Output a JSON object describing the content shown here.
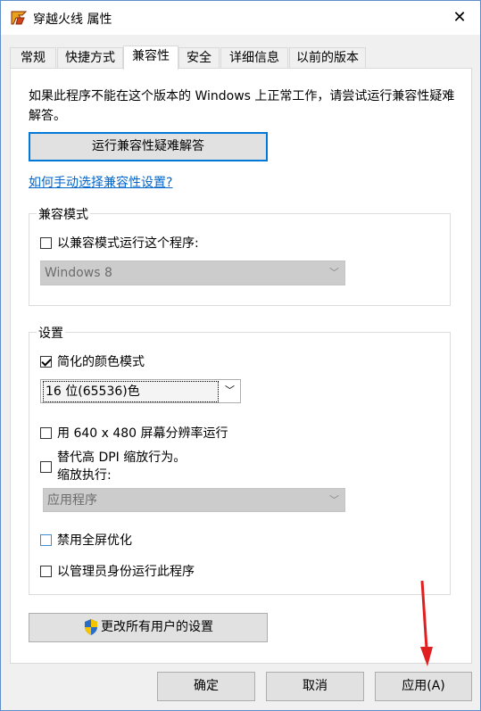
{
  "window": {
    "title": "穿越火线 属性",
    "close": "✕"
  },
  "tabs": [
    {
      "label": "常规"
    },
    {
      "label": "快捷方式"
    },
    {
      "label": "兼容性"
    },
    {
      "label": "安全"
    },
    {
      "label": "详细信息"
    },
    {
      "label": "以前的版本"
    }
  ],
  "compat": {
    "description": "如果此程序不能在这个版本的 Windows 上正常工作，请尝试运行兼容性疑难解答。",
    "troubleshoot_button": "运行兼容性疑难解答",
    "manual_link": "如何手动选择兼容性设置?"
  },
  "compat_mode": {
    "title": "兼容模式",
    "checkbox_label": "以兼容模式运行这个程序:",
    "checked": false,
    "os_select": "Windows 8"
  },
  "settings": {
    "title": "设置",
    "reduced_color_label": "简化的颜色模式",
    "reduced_color_checked": true,
    "color_select": "16 位(65536)色",
    "res_640_label": "用 640 x 480 屏幕分辨率运行",
    "dpi_label_line1": "替代高 DPI 缩放行为。",
    "dpi_label_line2": "缩放执行:",
    "dpi_select": "应用程序",
    "fullscreen_opt_label": "禁用全屏优化",
    "admin_label": "以管理员身份运行此程序"
  },
  "change_all_users_button": "更改所有用户的设置",
  "footer": {
    "ok": "确定",
    "cancel": "取消",
    "apply": "应用(A)"
  },
  "colors": {
    "accent": "#0078d7",
    "link": "#0066cc",
    "annotation_arrow": "#e02020"
  },
  "icons": {
    "app": "crossfire-app-icon",
    "shield": "uac-shield-icon",
    "chevron": "chevron-down-icon"
  }
}
